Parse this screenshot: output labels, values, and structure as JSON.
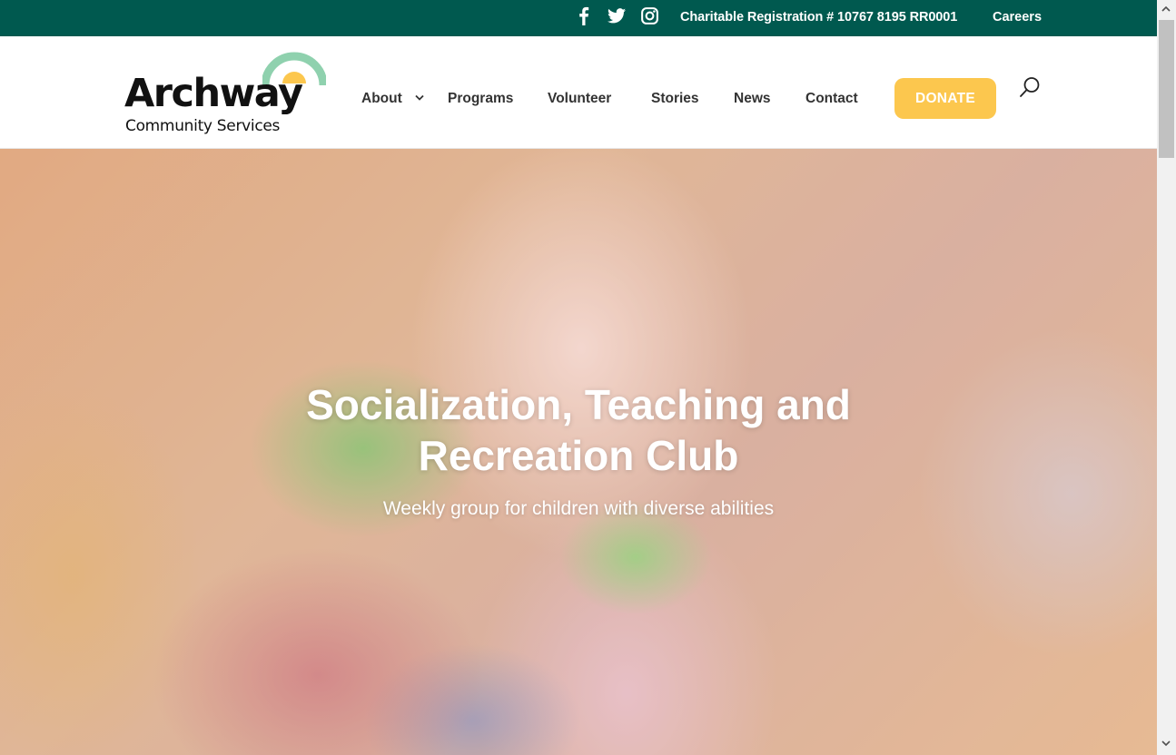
{
  "topbar": {
    "social_icons": [
      "facebook-icon",
      "twitter-icon",
      "instagram-icon"
    ],
    "registration": "Charitable Registration # 10767 8195 RR0001",
    "careers": "Careers"
  },
  "logo": {
    "name": "Archway",
    "subtitle": "Community Services"
  },
  "nav": {
    "items": [
      "About",
      "Programs",
      "Volunteer",
      "Stories",
      "News",
      "Contact"
    ],
    "donate": "DONATE"
  },
  "hero": {
    "title_line1": "Socialization, Teaching and",
    "title_line2": "Recreation Club",
    "subtitle": "Weekly group for children with diverse abilities"
  },
  "colors": {
    "topbar": "#00594f",
    "donate": "#fcc74e",
    "logo_arc_green": "#8fd1ae",
    "logo_arc_yellow": "#fcc74e",
    "nav_text": "#333333"
  }
}
